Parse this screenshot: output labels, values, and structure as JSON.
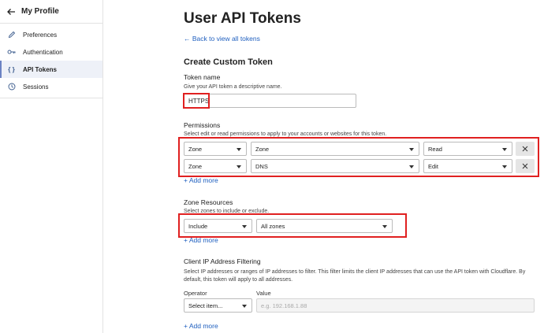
{
  "sidebar": {
    "title": "My Profile",
    "items": [
      {
        "label": "Preferences",
        "icon": "pencil-icon"
      },
      {
        "label": "Authentication",
        "icon": "key-icon"
      },
      {
        "label": "API Tokens",
        "icon": "braces-icon",
        "active": true
      },
      {
        "label": "Sessions",
        "icon": "clock-icon"
      }
    ]
  },
  "main": {
    "title": "User API Tokens",
    "back_link": "Back to view all tokens",
    "section_title": "Create Custom Token",
    "token_name": {
      "label": "Token name",
      "help": "Give your API token a descriptive name.",
      "value": "HTTPS"
    },
    "permissions": {
      "label": "Permissions",
      "help": "Select edit or read permissions to apply to your accounts or websites for this token.",
      "rows": [
        {
          "type": "Zone",
          "resource": "Zone",
          "access": "Read"
        },
        {
          "type": "Zone",
          "resource": "DNS",
          "access": "Edit"
        }
      ],
      "add_more": "+ Add more"
    },
    "zone_resources": {
      "label": "Zone Resources",
      "help": "Select zones to include or exclude.",
      "mode": "Include",
      "zones": "All zones",
      "add_more": "+ Add more"
    },
    "ip_filter": {
      "label": "Client IP Address Filtering",
      "help": "Select IP addresses or ranges of IP addresses to filter. This filter limits the client IP addresses that can use the API token with Cloudflare. By default, this token will apply to all addresses.",
      "operator_label": "Operator",
      "operator_placeholder": "Select item...",
      "value_label": "Value",
      "value_placeholder": "e.g. 192.168.1.88",
      "add_more": "+ Add more"
    }
  },
  "colors": {
    "link": "#1f5fbf",
    "highlight": "#e02020",
    "active_bg": "#eef1f8"
  }
}
